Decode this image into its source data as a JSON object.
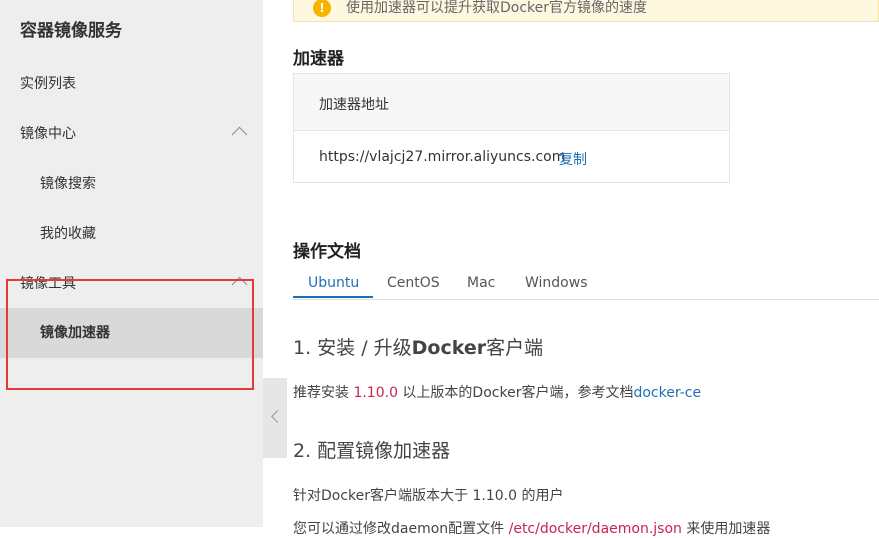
{
  "sidebar": {
    "title": "容器镜像服务",
    "items": {
      "instances": "实例列表",
      "mirror_center": "镜像中心",
      "mirror_search": "镜像搜索",
      "favorites": "我的收藏",
      "mirror_tools": "镜像工具",
      "accelerator": "镜像加速器"
    }
  },
  "banner": {
    "text": "使用加速器可以提升获取Docker官方镜像的速度"
  },
  "accelerator": {
    "heading": "加速器",
    "table_header": "加速器地址",
    "url": "https://vlajcj27.mirror.aliyuncs.com",
    "copy_label": "复制"
  },
  "docs": {
    "heading": "操作文档",
    "tabs": [
      "Ubuntu",
      "CentOS",
      "Mac",
      "Windows"
    ],
    "active_tab": "Ubuntu",
    "step1": {
      "title_prefix": "1. 安装 / 升级",
      "title_bold": "Docker",
      "title_suffix": "客户端",
      "text_before": "推荐安装 ",
      "version": "1.10.0",
      "text_after": " 以上版本的Docker客户端，参考文档",
      "link": "docker-ce"
    },
    "step2": {
      "title": "2. 配置镜像加速器",
      "text": "针对Docker客户端版本大于 1.10.0 的用户",
      "text2_before": "您可以通过修改daemon配置文件 ",
      "text2_path": "/etc/docker/daemon.json",
      "text2_after": " 来使用加速器"
    }
  },
  "colors": {
    "accent": "#1e6fb8",
    "highlight_border": "#e63a3a",
    "code_red": "#c7254e"
  }
}
